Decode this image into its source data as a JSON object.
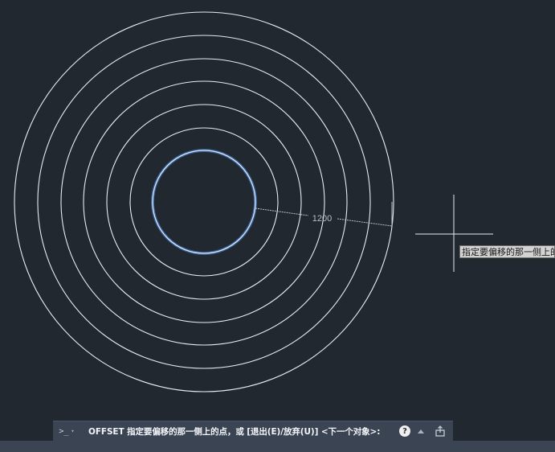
{
  "drawing": {
    "dimension_value": "1200",
    "circles": [
      {
        "radius": 64,
        "selected": true
      },
      {
        "radius": 92,
        "selected": false
      },
      {
        "radius": 121,
        "selected": false
      },
      {
        "radius": 150,
        "selected": false
      },
      {
        "radius": 178,
        "selected": false
      },
      {
        "radius": 207,
        "selected": false
      },
      {
        "radius": 236,
        "selected": false
      }
    ],
    "colors": {
      "background": "#212830",
      "circle": "#e8ecf1",
      "selected_circle": "#4f8fe8",
      "dimension": "#b8bfc8",
      "crosshair": "#e6e9ee"
    }
  },
  "cursor_tooltip": {
    "text": "指定要偏移的那一侧上的点"
  },
  "command_line": {
    "prompt_symbol": ">_",
    "prompt_caret": "▾",
    "text": "OFFSET 指定要偏移的那一侧上的点，或 [退出(E)/放弃(U)] <下一个对象>:",
    "help_label": "?",
    "icons": {
      "prompt": "command-prompt-icon",
      "help": "help-icon",
      "history": "arrow-up-icon",
      "share": "share-icon"
    }
  }
}
